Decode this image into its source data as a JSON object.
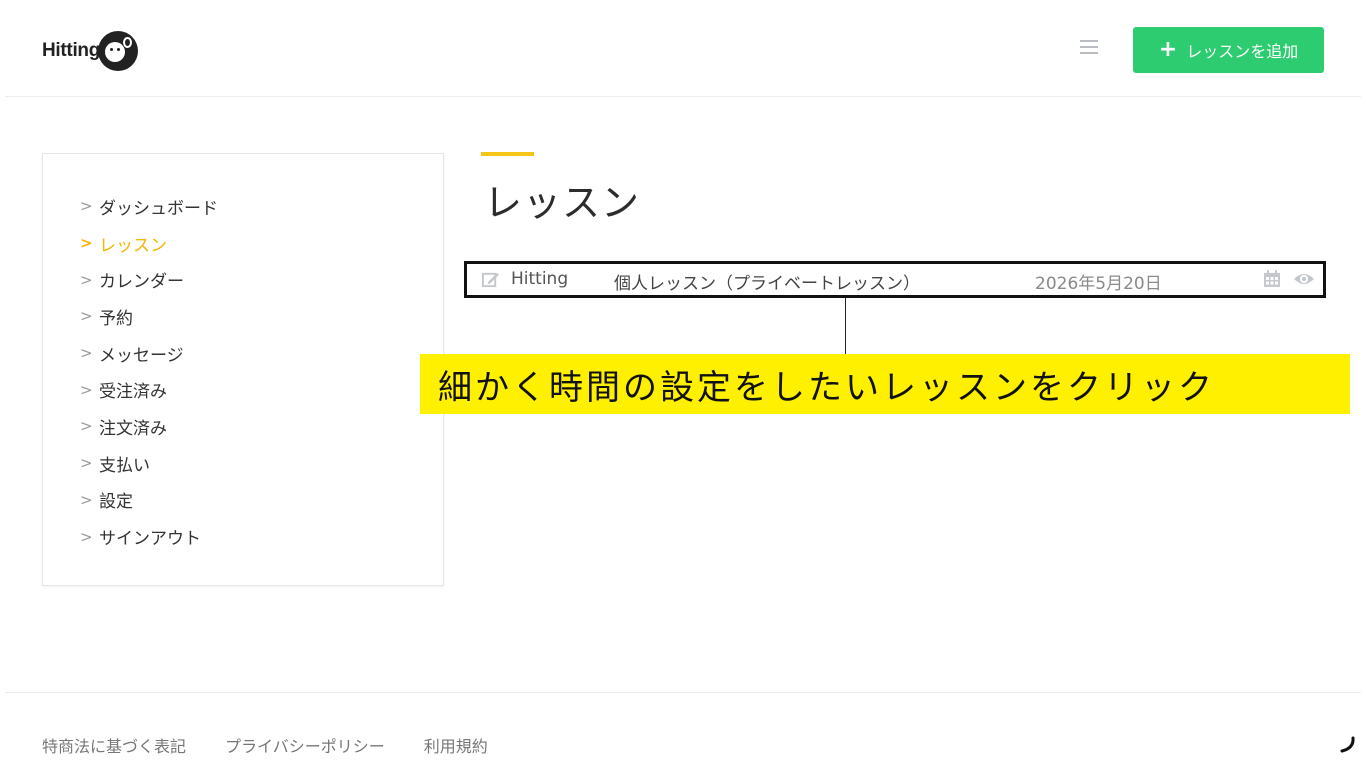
{
  "header": {
    "logo_text": "Hitting",
    "add_button_label": "レッスンを追加"
  },
  "sidebar": {
    "items": [
      {
        "label": "ダッシュボード",
        "active": false
      },
      {
        "label": "レッスン",
        "active": true
      },
      {
        "label": "カレンダー",
        "active": false
      },
      {
        "label": "予約",
        "active": false
      },
      {
        "label": "メッセージ",
        "active": false
      },
      {
        "label": "受注済み",
        "active": false
      },
      {
        "label": "注文済み",
        "active": false
      },
      {
        "label": "支払い",
        "active": false
      },
      {
        "label": "設定",
        "active": false
      },
      {
        "label": "サインアウト",
        "active": false
      }
    ]
  },
  "main": {
    "title": "レッスン",
    "lessons": [
      {
        "organizer": "Hitting",
        "name": "個人レッスン（プライベートレッスン）",
        "date": "2026年5月20日"
      }
    ]
  },
  "annotation": {
    "text": "細かく時間の設定をしたいレッスンをクリック"
  },
  "footer": {
    "links": [
      "特商法に基づく表記",
      "プライバシーポリシー",
      "利用規約"
    ]
  },
  "colors": {
    "accent": "#f5c518",
    "active_menu": "#f5b700",
    "add_button": "#2ecc71",
    "callout_bg": "#fff000"
  }
}
